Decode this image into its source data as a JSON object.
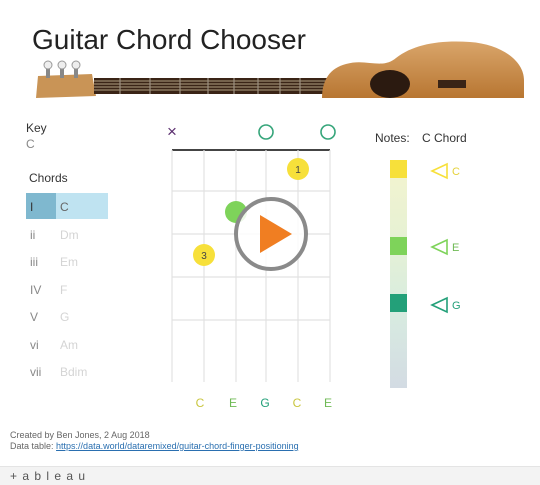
{
  "title": "Guitar Chord Chooser",
  "key": {
    "label": "Key",
    "value": "C"
  },
  "chords": {
    "label": "Chords",
    "items": [
      {
        "roman": "I",
        "name": "C",
        "selected": true
      },
      {
        "roman": "ii",
        "name": "Dm",
        "selected": false
      },
      {
        "roman": "iii",
        "name": "Em",
        "selected": false
      },
      {
        "roman": "IV",
        "name": "F",
        "selected": false
      },
      {
        "roman": "V",
        "name": "G",
        "selected": false
      },
      {
        "roman": "vi",
        "name": "Am",
        "selected": false
      },
      {
        "roman": "vii",
        "name": "Bdim",
        "selected": false
      }
    ]
  },
  "fretboard": {
    "string_markers": [
      "×",
      "",
      "",
      "○",
      "",
      "○"
    ],
    "string_notes": [
      "C",
      "E",
      "G",
      "C",
      "E"
    ],
    "fingers": [
      {
        "label": "1",
        "string": 5,
        "fret": 1
      },
      {
        "label": "",
        "string": 3,
        "fret": 2
      },
      {
        "label": "3",
        "string": 2,
        "fret": 3
      }
    ]
  },
  "notes": {
    "label": "Notes:",
    "chord": "C Chord",
    "markers": [
      "C",
      "E",
      "G"
    ]
  },
  "footer": {
    "created": "Created by Ben Jones, 2 Aug 2018",
    "datatable_label": "Data table:",
    "datatable_link": "https://data.world/dataremixed/guitar-chord-finger-positioning"
  },
  "brand": "+ a b l e a u",
  "colors": {
    "accent_blue": "#7fb8cf",
    "selected_bg": "#bfe3f1",
    "note_c": "#f7e03a",
    "note_e": "#7ed35a",
    "note_g": "#23a079",
    "mute_x": "#5a2d6e",
    "open_circle": "#35a57a"
  }
}
